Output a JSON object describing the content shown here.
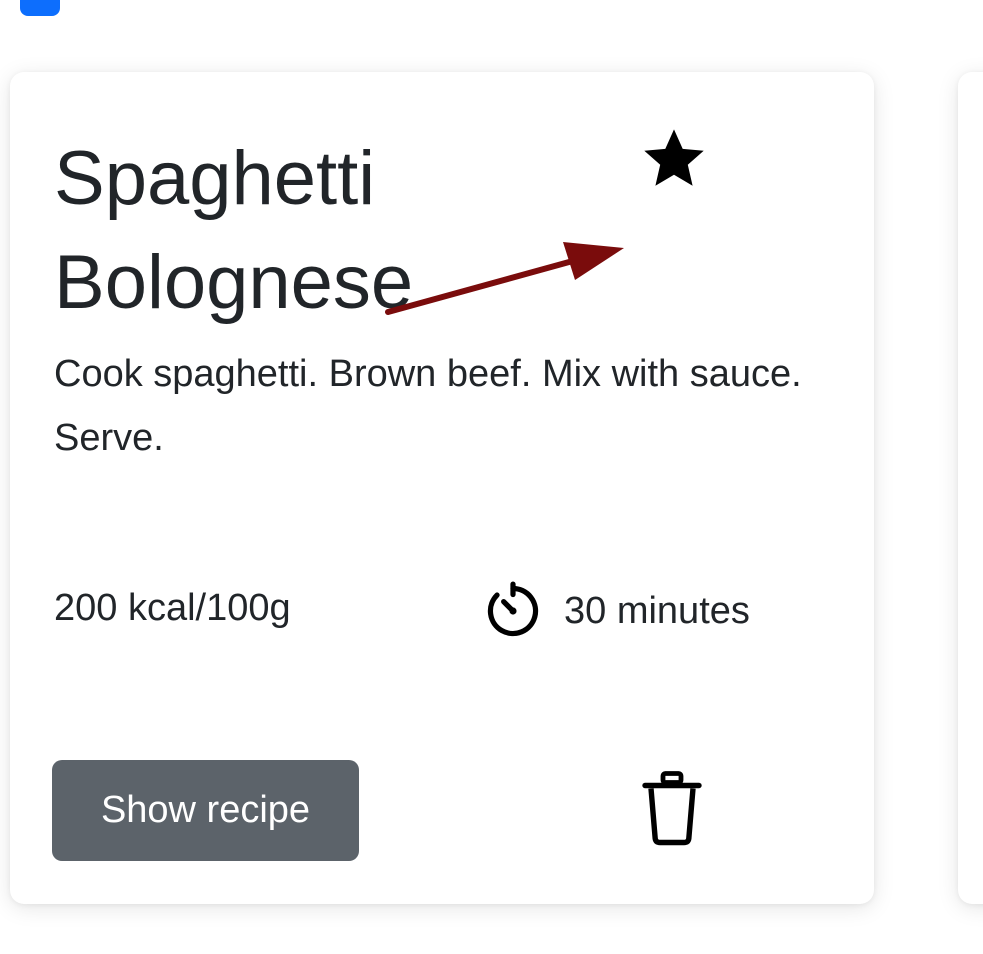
{
  "recipe_card": {
    "title": "Spaghetti Bolognese",
    "description": "Cook spaghetti. Brown beef. Mix with sauce. Serve.",
    "calories": "200 kcal/100g",
    "duration": "30 minutes",
    "favorite_icon": "star-filled-icon",
    "timer_icon": "timer-icon",
    "delete_icon": "trash-icon",
    "show_recipe_label": "Show recipe"
  },
  "colors": {
    "button_background": "#5c636a",
    "button_text": "#ffffff",
    "annotation_arrow": "#7a0c0c",
    "checkbox_accent": "#0d6efd",
    "text": "#212529"
  }
}
